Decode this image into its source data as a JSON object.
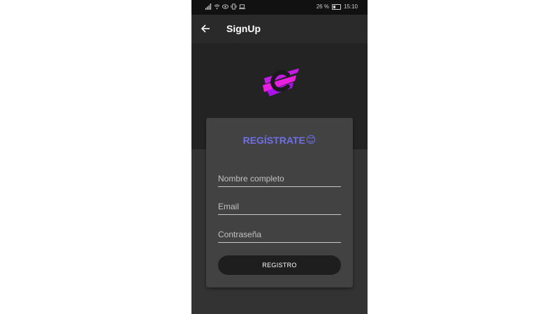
{
  "status_bar": {
    "battery_percent": "26 %",
    "time": "15:10"
  },
  "app_bar": {
    "title": "SignUp",
    "back_icon": "arrow-left-icon"
  },
  "logo": {
    "icon": "brush-c-logo",
    "colors": [
      "#e81ee0",
      "#a814e8"
    ]
  },
  "card": {
    "title": "REGÍSTRATE",
    "title_emoji": "😊",
    "title_color": "#6f6fe6",
    "fields": [
      {
        "name": "full-name",
        "placeholder": "Nombre completo",
        "value": ""
      },
      {
        "name": "email",
        "placeholder": "Email",
        "value": ""
      },
      {
        "name": "password",
        "placeholder": "Contraseña",
        "value": ""
      }
    ],
    "register_label": "REGISTRO"
  }
}
